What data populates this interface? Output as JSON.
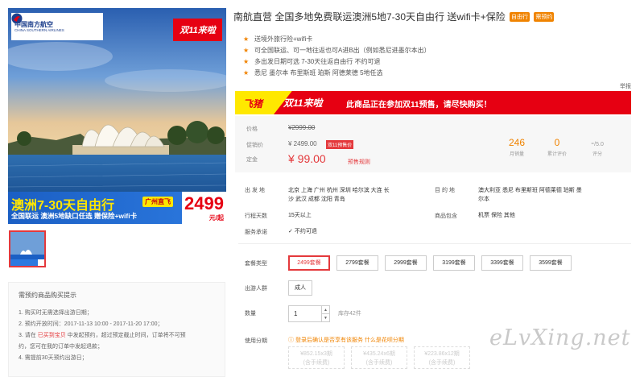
{
  "hero": {
    "airline_cn": "中国南方航空",
    "airline_en": "CHINA SOUTHERN AIRLINES",
    "badge": "双11来啦",
    "banner_title": "澳洲7-30天自由行",
    "banner_city": "广州直飞",
    "banner_sub": "全国联运 澳洲5地缺口任选 赠保险+wifi卡",
    "price": "2499",
    "price_unit": "元/起"
  },
  "notice": {
    "heading": "需预约商品购买提示",
    "line1": "1. 购买时无需选择出游日期；",
    "line2": "2. 预约开放时间：2017-11-13 10:00 - 2017-11-20 17:00；",
    "line3_a": "3. 请在 ",
    "line3_link": "已买到宝贝",
    "line3_b": " 中发起预约，超过预定截止时间，订单将不可预",
    "line4": "约，您可在我的订单中发起退款；",
    "line5": "4. 需提前30天预约出游日；"
  },
  "title": {
    "text": "南航直营 全国多地免费联运澳洲5地7-30天自由行 送wifi卡+保险",
    "tag1": "自由行",
    "tag2": "需预约"
  },
  "bullets": [
    "送境外旅行险+wifi卡",
    "可全国联运、可一地往返也可A进B出（例如悉尼进墨尔本出）",
    "多出发日期可选 7-30天往返自由行 不约可退",
    "悉尼 墨尔本 布里斯班 珀斯 阿德莱德 5地任选"
  ],
  "report": "举报",
  "promo": {
    "brand": "飞猪",
    "event": "双11来啦",
    "message": "此商品正在参加双11预售，请尽快购买！"
  },
  "price": {
    "label_price": "价格",
    "original": "¥2999.00",
    "label_promo": "促销价",
    "promo_price": "¥ 2499.00",
    "presale_tag": "双11预售价",
    "label_deposit": "定金",
    "deposit": "¥ 99.00",
    "rule": "预售规则",
    "sales_num": "246",
    "sales_lbl": "月销量",
    "review_num": "0",
    "review_lbl": "累计评价",
    "score_num": "-",
    "score_max": "/5.0",
    "score_lbl": "评分"
  },
  "info": {
    "depart_lbl": "出 发 地",
    "depart_val1": "北京 上海 广州 杭州 深圳 哈尔滨 大连 长",
    "depart_val2": "沙 武汉 成都 沈阳 青岛",
    "dest_lbl": "目 的 地",
    "dest_val1": "澳大利亚 悉尼 布里斯班 阿德莱德 珀斯 墨",
    "dest_val2": "尔本",
    "days_lbl": "行程天数",
    "days_val": "15天以上",
    "incl_lbl": "商品包含",
    "incl_val": "机票 保险 其他",
    "svc_lbl": "服务承诺",
    "svc_val": "不约可退"
  },
  "packages": {
    "label": "套餐类型",
    "items": [
      "2499套餐",
      "2799套餐",
      "2999套餐",
      "3199套餐",
      "3399套餐",
      "3599套餐"
    ]
  },
  "people": {
    "label": "出游人群",
    "value": "成人"
  },
  "quantity": {
    "label": "数量",
    "value": "1",
    "stock": "库存42件"
  },
  "installment": {
    "label": "使用分期",
    "note": "登录后确认是否享有该服务",
    "link": "什么是花呗分期",
    "opt1_a": "¥852.15x3期",
    "opt1_b": "(含手续费)",
    "opt2_a": "¥435.24x6期",
    "opt2_b": "(含手续费)",
    "opt3_a": "¥223.86x12期",
    "opt3_b": "(含手续费)"
  },
  "watermark": "eLvXing.net",
  "colors": {
    "accent": "#e4393c",
    "orange": "#f08300",
    "yellow": "#ffe800"
  }
}
